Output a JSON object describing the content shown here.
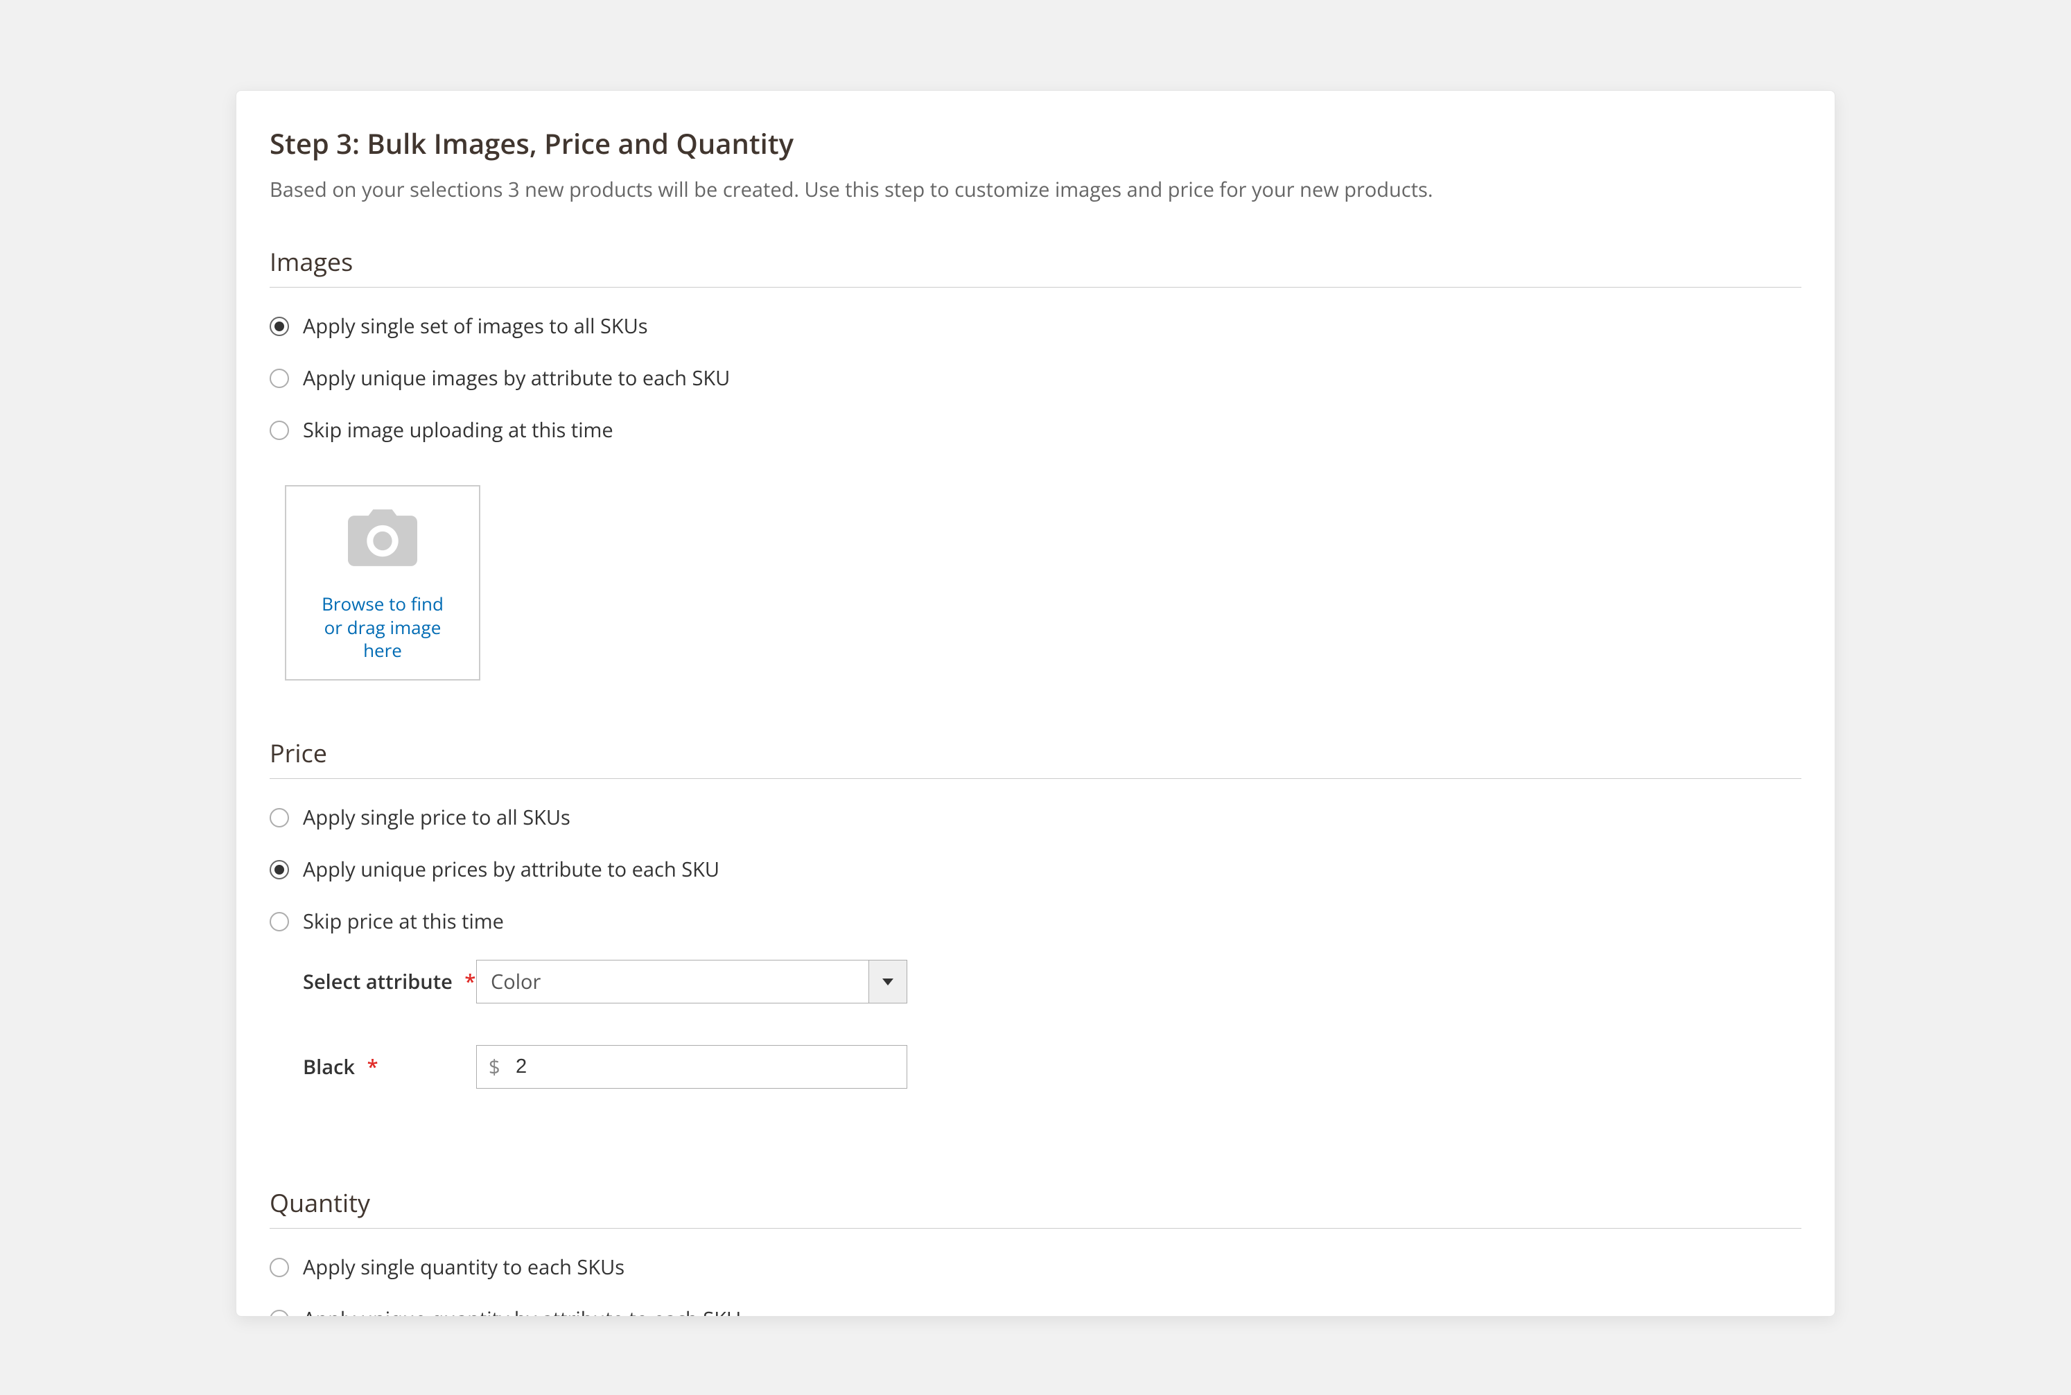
{
  "header": {
    "title": "Step 3: Bulk Images, Price and Quantity",
    "subtitle": "Based on your selections 3 new products will be created. Use this step to customize images and price for your new products."
  },
  "sections": {
    "images": {
      "title": "Images",
      "options": [
        "Apply single set of images to all SKUs",
        "Apply unique images by attribute to each SKU",
        "Skip image uploading at this time"
      ],
      "selected": 0,
      "uploader_text": "Browse to find or drag image here"
    },
    "price": {
      "title": "Price",
      "options": [
        "Apply single price to all SKUs",
        "Apply unique prices by attribute to each SKU",
        "Skip price at this time"
      ],
      "selected": 1,
      "attribute_label": "Select attribute",
      "attribute_value": "Color",
      "row_label": "Black",
      "currency": "$",
      "row_value": "2"
    },
    "quantity": {
      "title": "Quantity",
      "options": [
        "Apply single quantity to each SKUs",
        "Apply unique quantity by attribute to each SKU"
      ]
    }
  }
}
